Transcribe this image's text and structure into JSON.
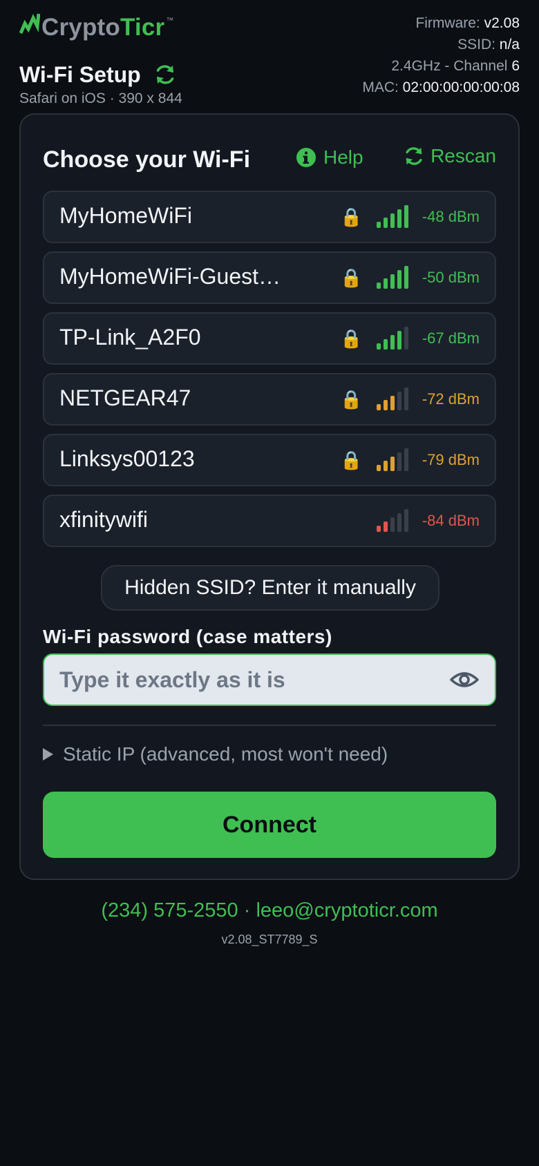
{
  "brand": {
    "name_part1": "Crypto",
    "name_part2": "Ticr",
    "tm": "™",
    "accent_color": "#3fbf52",
    "logo_icon": "chart-logo-icon"
  },
  "header": {
    "title": "Wi-Fi Setup",
    "subtitle": "Safari on iOS · 390 x 844",
    "refresh_icon": "refresh-icon"
  },
  "device_info": {
    "firmware_label": "Firmware:",
    "firmware_value": "v2.08",
    "ssid_label": "SSID:",
    "ssid_value": "n/a",
    "channel_label": "2.4GHz - Channel",
    "channel_value": "6",
    "mac_label": "MAC:",
    "mac_value": "02:00:00:00:00:08"
  },
  "card": {
    "title": "Choose your Wi-Fi",
    "help_label": "Help",
    "help_icon": "info-icon",
    "rescan_label": "Rescan",
    "rescan_icon": "refresh-icon"
  },
  "networks": [
    {
      "name": "MyHomeWiFi",
      "locked": true,
      "signal_bars": 5,
      "signal": "-48 dBm",
      "color": "#3fbf52"
    },
    {
      "name": "MyHomeWiFi-Guest…",
      "locked": true,
      "signal_bars": 5,
      "signal": "-50 dBm",
      "color": "#3fbf52"
    },
    {
      "name": "TP-Link_A2F0",
      "locked": true,
      "signal_bars": 4,
      "signal": "-67 dBm",
      "color": "#3fbf52"
    },
    {
      "name": "NETGEAR47",
      "locked": true,
      "signal_bars": 3,
      "signal": "-72 dBm",
      "color": "#e0a030"
    },
    {
      "name": "Linksys00123",
      "locked": true,
      "signal_bars": 3,
      "signal": "-79 dBm",
      "color": "#e0a030"
    },
    {
      "name": "xfinitywifi",
      "locked": false,
      "signal_bars": 2,
      "signal": "-84 dBm",
      "color": "#e5534b"
    }
  ],
  "lock_glyph": "🔒",
  "hidden_ssid_label": "Hidden SSID? Enter it manually",
  "password": {
    "label": "Wi-Fi password (case matters)",
    "placeholder": "Type it exactly as it is",
    "value": "",
    "toggle_icon": "eye-icon"
  },
  "static_ip_label": "Static IP (advanced, most won't need)",
  "connect_label": "Connect",
  "footer": {
    "phone": "(234) 575-2550",
    "separator": "·",
    "email": "leeo@cryptoticr.com",
    "version": "v2.08_ST7789_S"
  }
}
